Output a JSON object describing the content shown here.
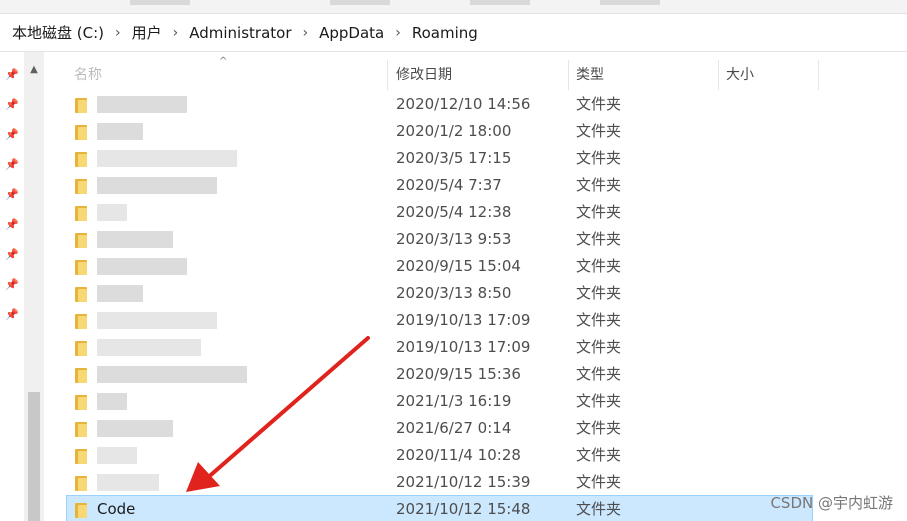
{
  "address_bar": {
    "crumbs": [
      "本地磁盘 (C:)",
      "用户",
      "Administrator",
      "AppData",
      "Roaming"
    ]
  },
  "columns": {
    "name": "名称",
    "date_modified": "修改日期",
    "type": "类型",
    "size": "大小"
  },
  "rows": [
    {
      "name": "",
      "date": "2020/12/10 14:56",
      "type": "文件夹"
    },
    {
      "name": "",
      "date": "2020/1/2 18:00",
      "type": "文件夹"
    },
    {
      "name": "",
      "date": "2020/3/5 17:15",
      "type": "文件夹"
    },
    {
      "name": "",
      "date": "2020/5/4 7:37",
      "type": "文件夹"
    },
    {
      "name": "",
      "date": "2020/5/4 12:38",
      "type": "文件夹"
    },
    {
      "name": "",
      "date": "2020/3/13 9:53",
      "type": "文件夹"
    },
    {
      "name": "",
      "date": "2020/9/15 15:04",
      "type": "文件夹"
    },
    {
      "name": "",
      "date": "2020/3/13 8:50",
      "type": "文件夹"
    },
    {
      "name": "",
      "date": "2019/10/13 17:09",
      "type": "文件夹"
    },
    {
      "name": "",
      "date": "2019/10/13 17:09",
      "type": "文件夹"
    },
    {
      "name": "",
      "date": "2020/9/15 15:36",
      "type": "文件夹"
    },
    {
      "name": "",
      "date": "2021/1/3 16:19",
      "type": "文件夹"
    },
    {
      "name": "",
      "date": "2021/6/27 0:14",
      "type": "文件夹"
    },
    {
      "name": "",
      "date": "2020/11/4 10:28",
      "type": "文件夹"
    },
    {
      "name": "",
      "date": "2021/10/12 15:39",
      "type": "文件夹"
    },
    {
      "name": "Code",
      "date": "2021/10/12 15:48",
      "type": "文件夹",
      "selected": true
    }
  ],
  "watermark": "CSDN @宇内虹游",
  "colors": {
    "selection_bg": "#cce8ff",
    "selection_border": "#99d1ff",
    "folder": "#f8d775",
    "arrow": "#e0231c"
  },
  "icons": [
    "pin-icon",
    "folder-icon",
    "chevron-right-icon",
    "chevron-up-icon",
    "sort-caret-icon"
  ]
}
